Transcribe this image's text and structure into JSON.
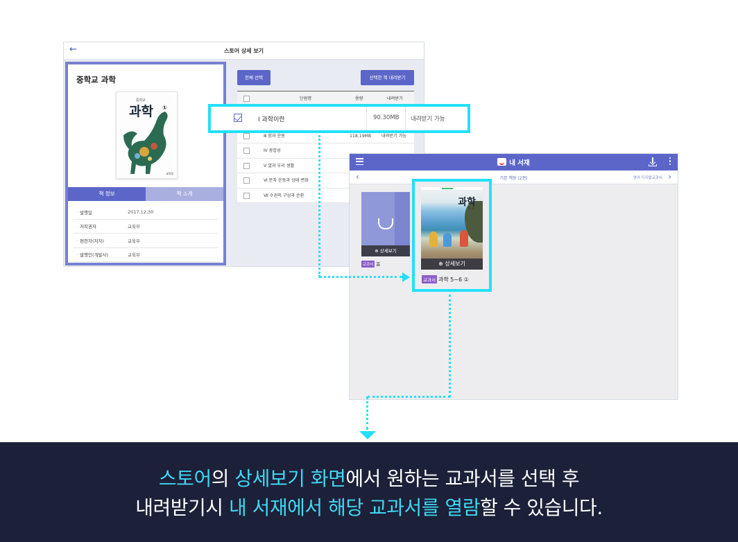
{
  "store": {
    "title": "스토어 상세 보기",
    "back_icon": "←",
    "book_title": "중학교 과학",
    "cover": {
      "small_text": "중학교",
      "title": "과학",
      "grade": "①",
      "publisher": "교육부"
    },
    "tabs": [
      {
        "label": "책 정보",
        "active": true
      },
      {
        "label": "책 소개",
        "active": false
      }
    ],
    "info": [
      {
        "label": "발행일",
        "value": "2017.12.30"
      },
      {
        "label": "저작권자",
        "value": "교육부"
      },
      {
        "label": "편찬자(저자)",
        "value": "교육부"
      },
      {
        "label": "발행인(개발사)",
        "value": "교육부"
      }
    ],
    "select_all_label": "전체 선택",
    "download_selected_label": "선택한 책 내려받기",
    "table": {
      "headers": {
        "name": "단원명",
        "size": "용량",
        "download": "내려받기"
      },
      "selected_row": {
        "name": "Ⅰ 과학이란",
        "size": "90.30MB",
        "status": "내려받기 가능",
        "checked": true
      },
      "rows": [
        {
          "name": "Ⅲ 힘과 운동",
          "size": "118.19MB",
          "status": "내려받기 가능"
        },
        {
          "name": "Ⅳ 광합성",
          "size": "",
          "status": ""
        },
        {
          "name": "Ⅴ 열과 우리 생활",
          "size": "",
          "status": ""
        },
        {
          "name": "Ⅵ 분자 운동과 상태 변화",
          "size": "",
          "status": ""
        },
        {
          "name": "Ⅶ 수권의 구성과 순환",
          "size": "",
          "status": ""
        }
      ]
    }
  },
  "library": {
    "title": "내 서재",
    "shelf_label": "기본 책장 (2권)",
    "english_link": "영어 디지털교과서",
    "prev_icon": "‹",
    "next_icon": "›",
    "books": [
      {
        "badge": "교과서",
        "title": "봄",
        "detail_label": "⊕ 상세보기"
      },
      {
        "badge": "교과서",
        "title": "과학 5~6 ①",
        "detail_label": "⊕ 상세보기",
        "cover_title": "과학",
        "cover_grade": "5-1"
      }
    ]
  },
  "caption": {
    "line1": [
      {
        "text": "스토어",
        "highlight": true
      },
      {
        "text": "의 ",
        "highlight": false
      },
      {
        "text": "상세보기 화면",
        "highlight": true
      },
      {
        "text": "에서 원하는 교과서를 선택 후",
        "highlight": false
      }
    ],
    "line2": [
      {
        "text": "내려받기시 ",
        "highlight": false
      },
      {
        "text": "내 서재에서 해당 교과서를 열람",
        "highlight": true
      },
      {
        "text": "할 수 있습니다.",
        "highlight": false
      }
    ]
  },
  "colors": {
    "accent": "#5c66c9",
    "highlight": "#22e0f8",
    "banner_bg": "#1c2038",
    "caption_highlight": "#3fd8f2"
  }
}
